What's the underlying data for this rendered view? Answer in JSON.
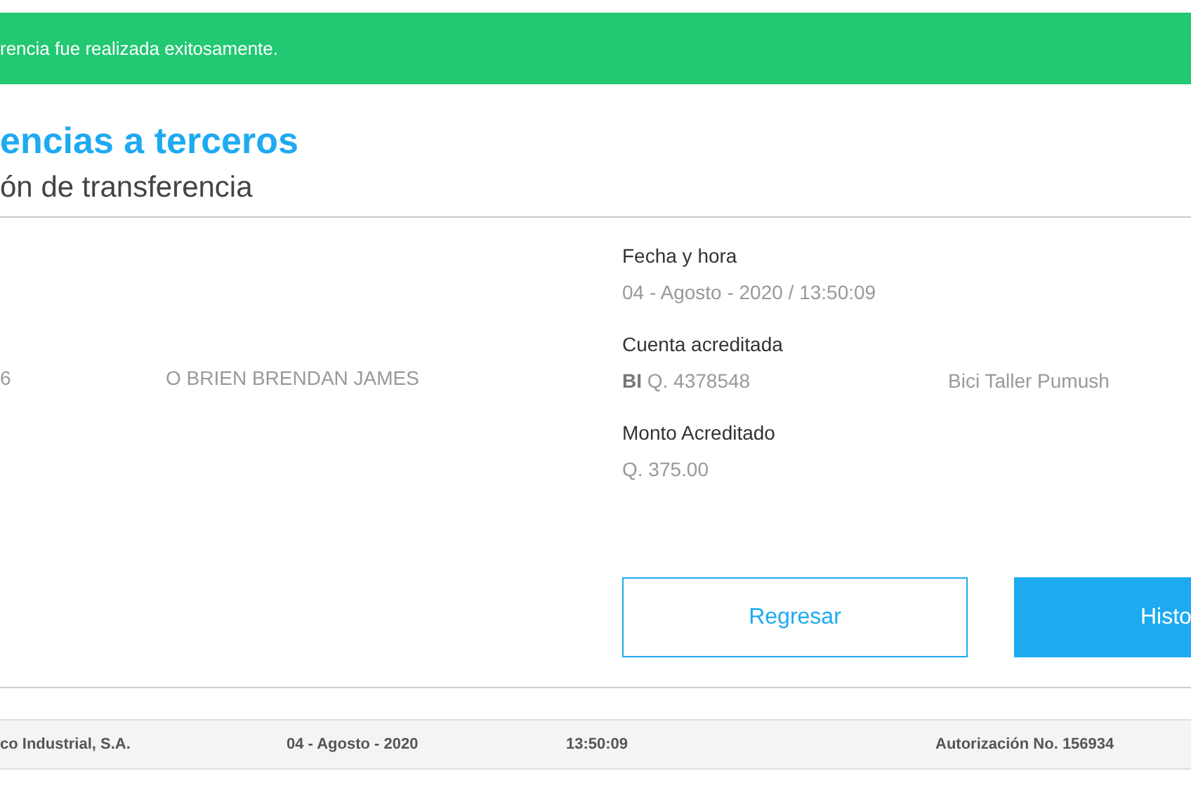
{
  "alert": {
    "message": "rencia fue realizada exitosamente."
  },
  "title": "encias a terceros",
  "subtitle": "ón de transferencia",
  "debit": {
    "account": "6",
    "holder": "O BRIEN BRENDAN JAMES"
  },
  "details": [
    {
      "label": "Fecha y hora",
      "value": "04 - Agosto - 2020 / 13:50:09"
    },
    {
      "label": "Cuenta acreditada",
      "value": "**BI** Q. 4378548",
      "extra": "Bici Taller Pumush"
    },
    {
      "label": "Monto Acreditado",
      "value": "Q. 375.00"
    }
  ],
  "buttons": [
    {
      "label": "Regresar",
      "kind": "outline"
    },
    {
      "label": "Histo",
      "kind": "filled"
    }
  ],
  "footer": [
    "co Industrial, S.A.",
    "04 - Agosto - 2020",
    "13:50:09",
    "Autorización No. 156934"
  ]
}
